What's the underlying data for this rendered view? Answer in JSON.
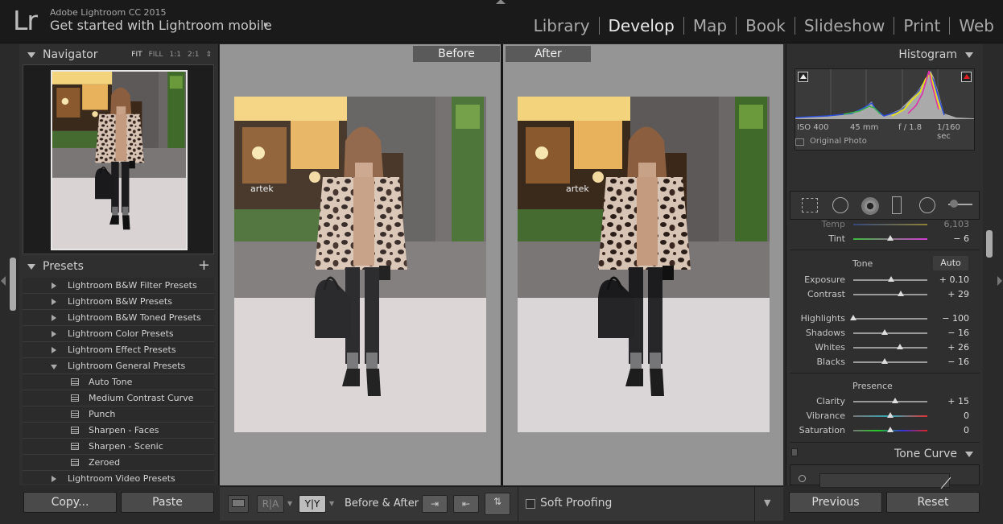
{
  "app": {
    "logo": "Lr",
    "name": "Adobe Lightroom CC 2015",
    "mobile_prompt": "Get started with Lightroom mobile",
    "mobile_arrow": "▸"
  },
  "modules": [
    "Library",
    "Develop",
    "Map",
    "Book",
    "Slideshow",
    "Print",
    "Web"
  ],
  "active_module": "Develop",
  "navigator": {
    "title": "Navigator",
    "modes": [
      "FIT",
      "FILL",
      "1:1",
      "2:1"
    ],
    "active_mode": "FIT",
    "mode_stepper": "⇕"
  },
  "presets": {
    "title": "Presets",
    "add": "+",
    "items": [
      {
        "label": "Lightroom B&W Filter Presets",
        "type": "folder",
        "open": false
      },
      {
        "label": "Lightroom B&W Presets",
        "type": "folder",
        "open": false
      },
      {
        "label": "Lightroom B&W Toned Presets",
        "type": "folder",
        "open": false
      },
      {
        "label": "Lightroom Color Presets",
        "type": "folder",
        "open": false
      },
      {
        "label": "Lightroom Effect Presets",
        "type": "folder",
        "open": false
      },
      {
        "label": "Lightroom General Presets",
        "type": "folder",
        "open": true
      },
      {
        "label": "Auto Tone",
        "type": "preset"
      },
      {
        "label": "Medium Contrast Curve",
        "type": "preset"
      },
      {
        "label": "Punch",
        "type": "preset"
      },
      {
        "label": "Sharpen - Faces",
        "type": "preset"
      },
      {
        "label": "Sharpen - Scenic",
        "type": "preset"
      },
      {
        "label": "Zeroed",
        "type": "preset"
      },
      {
        "label": "Lightroom Video Presets",
        "type": "folder",
        "open": false
      }
    ]
  },
  "left_buttons": {
    "copy": "Copy...",
    "paste": "Paste"
  },
  "compare": {
    "before": "Before",
    "after": "After",
    "shop_sign": "artek"
  },
  "toolbar": {
    "view_loupe": "",
    "view_ra": "R|A",
    "view_yy": "Y|Y",
    "before_after_label": "Before & After :",
    "soft_proofing": "Soft Proofing",
    "menu_arrow": "▼"
  },
  "histogram": {
    "title": "Histogram",
    "iso": "ISO 400",
    "focal": "45 mm",
    "aperture": "f / 1.8",
    "shutter": "1/160 sec",
    "original_photo": "Original Photo"
  },
  "basic": {
    "temp": {
      "label": "Temp",
      "value": "6,103"
    },
    "tint": {
      "label": "Tint",
      "value": "− 6",
      "pos": 0.5
    },
    "tone_title": "Tone",
    "auto": "Auto",
    "exposure": {
      "label": "Exposure",
      "value": "+ 0.10",
      "pos": 0.51
    },
    "contrast": {
      "label": "Contrast",
      "value": "+ 29",
      "pos": 0.64
    },
    "highlights": {
      "label": "Highlights",
      "value": "− 100",
      "pos": 0.0
    },
    "shadows": {
      "label": "Shadows",
      "value": "− 16",
      "pos": 0.42
    },
    "whites": {
      "label": "Whites",
      "value": "+ 26",
      "pos": 0.63
    },
    "blacks": {
      "label": "Blacks",
      "value": "− 16",
      "pos": 0.42
    },
    "presence_title": "Presence",
    "clarity": {
      "label": "Clarity",
      "value": "+ 15",
      "pos": 0.57
    },
    "vibrance": {
      "label": "Vibrance",
      "value": "0",
      "pos": 0.5
    },
    "saturation": {
      "label": "Saturation",
      "value": "0",
      "pos": 0.5
    }
  },
  "tone_curve": {
    "title": "Tone Curve"
  },
  "right_buttons": {
    "previous": "Previous",
    "reset": "Reset"
  },
  "colors": {
    "accent": "#e0e0e0",
    "panel": "#2f2f2f",
    "canvas": "#959595"
  }
}
